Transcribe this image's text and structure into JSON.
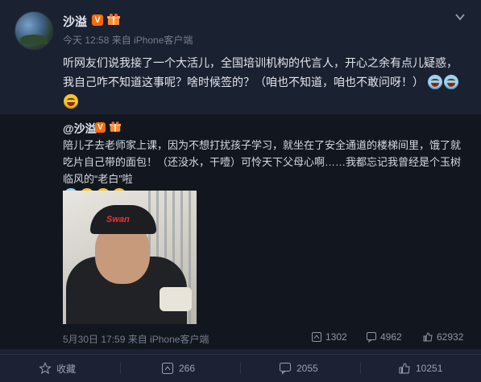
{
  "post": {
    "username": "沙溢",
    "verified_badge": "V",
    "meta": "今天 12:58 来自 iPhone客户端",
    "text": "听网友们说我接了一个大活儿，全国培训机构的代言人，开心之余有点儿疑惑，我自己咋不知道这事呢？啥时候签的？（咱也不知道，咱也不敢问呀！）"
  },
  "repost": {
    "username": "@沙溢",
    "verified_badge": "V",
    "text": "陪儿子去老师家上课，因为不想打扰孩子学习，就坐在了安全通道的楼梯间里，饿了就吃片自己带的面包！（还没水，干噎）可怜天下父母心啊……我都忘记我曾经是个玉树临风的“老白”啦",
    "photo_cap_text": "Swan",
    "meta": "5月30日 17:59 来自 iPhone客户端",
    "stats": {
      "reposts": "1302",
      "comments": "4962",
      "likes": "62932"
    }
  },
  "actions": {
    "favorite": "收藏",
    "repost": "266",
    "comment": "2055",
    "like": "10251"
  },
  "colors": {
    "accent_orange": "#ff6a00",
    "bg": "#1c2233",
    "repost_bg": "#12171f"
  },
  "icons": [
    "chevron-down-icon",
    "verified-icon",
    "gift-icon",
    "repost-icon",
    "comment-icon",
    "like-icon",
    "favorite-icon"
  ]
}
